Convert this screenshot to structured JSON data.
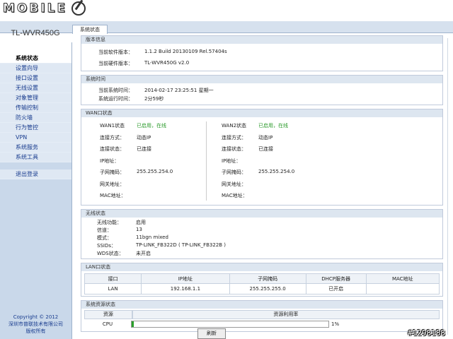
{
  "logo": {
    "text": "MOBILE"
  },
  "model": "TL-WVR450G",
  "active_tab": "系统状态",
  "sidebar": {
    "items": [
      {
        "label": "系统状态",
        "active": true
      },
      {
        "label": "设置向导"
      },
      {
        "label": "接口设置"
      },
      {
        "label": "无线设置"
      },
      {
        "label": "对象管理"
      },
      {
        "label": "传输控制"
      },
      {
        "label": "防火墙"
      },
      {
        "label": "行为管控"
      },
      {
        "label": "VPN"
      },
      {
        "label": "系统服务"
      },
      {
        "label": "系统工具"
      }
    ],
    "logout": "退出登录",
    "footer": [
      "Copyright © 2012",
      "深圳市普联技术有限公司",
      "版权所有"
    ]
  },
  "version": {
    "title": "版本信息",
    "software_label": "当前软件版本：",
    "software_value": "1.1.2 Build 20130109 Rel.57404s",
    "hardware_label": "当前硬件版本：",
    "hardware_value": "TL-WVR450G v2.0"
  },
  "systime": {
    "title": "系统时间",
    "time_label": "当前系统时间：",
    "time_value": "2014-02-17 23:25:51 星期一",
    "uptime_label": "系统运行时间：",
    "uptime_value": "2分59秒"
  },
  "wan": {
    "title": "WAN口状态",
    "ports": [
      {
        "status_label": "WAN1状态",
        "status_value": "已启用，在线",
        "conn_type_label": "连接方式：",
        "conn_type_value": "动态IP",
        "conn_status_label": "连接状态：",
        "conn_status_value": "已连接",
        "ip_label": "IP地址：",
        "ip_value": "",
        "mask_label": "子网掩码：",
        "mask_value": "255.255.254.0",
        "gw_label": "网关地址：",
        "gw_value": "",
        "mac_label": "MAC地址：",
        "mac_value": ""
      },
      {
        "status_label": "WAN2状态",
        "status_value": "已启用，在线",
        "conn_type_label": "连接方式：",
        "conn_type_value": "动态IP",
        "conn_status_label": "连接状态：",
        "conn_status_value": "已连接",
        "ip_label": "IP地址：",
        "ip_value": "",
        "mask_label": "子网掩码：",
        "mask_value": "255.255.254.0",
        "gw_label": "网关地址：",
        "gw_value": "",
        "mac_label": "MAC地址：",
        "mac_value": ""
      }
    ]
  },
  "wireless": {
    "title": "无线状态",
    "func_label": "无线功能：",
    "func_value": "启用",
    "channel_label": "信道：",
    "channel_value": "13",
    "mode_label": "模式：",
    "mode_value": "11bgn mixed",
    "ssid_label": "SSIDs：",
    "ssid_value": "TP-LINK_FB322D ( TP-LINK_FB322B )",
    "wds_label": "WDS状态：",
    "wds_value": "未开启"
  },
  "lan": {
    "title": "LAN口状态",
    "headers": [
      "接口",
      "IP地址",
      "子网掩码",
      "DHCP服务器",
      "MAC地址"
    ],
    "rows": [
      [
        "LAN",
        "192.168.1.1",
        "255.255.255.0",
        "已开启",
        ""
      ]
    ]
  },
  "resources": {
    "title": "系统资源状态",
    "headers": [
      "资源",
      "资源利用率"
    ],
    "rows": [
      {
        "name": "CPU",
        "percent": 1,
        "percent_text": "1%"
      }
    ]
  },
  "refresh_label": "刷新",
  "stamp": "#1298188",
  "colors": {
    "online": "#2a9a2a",
    "progress": "#2aa02a"
  }
}
